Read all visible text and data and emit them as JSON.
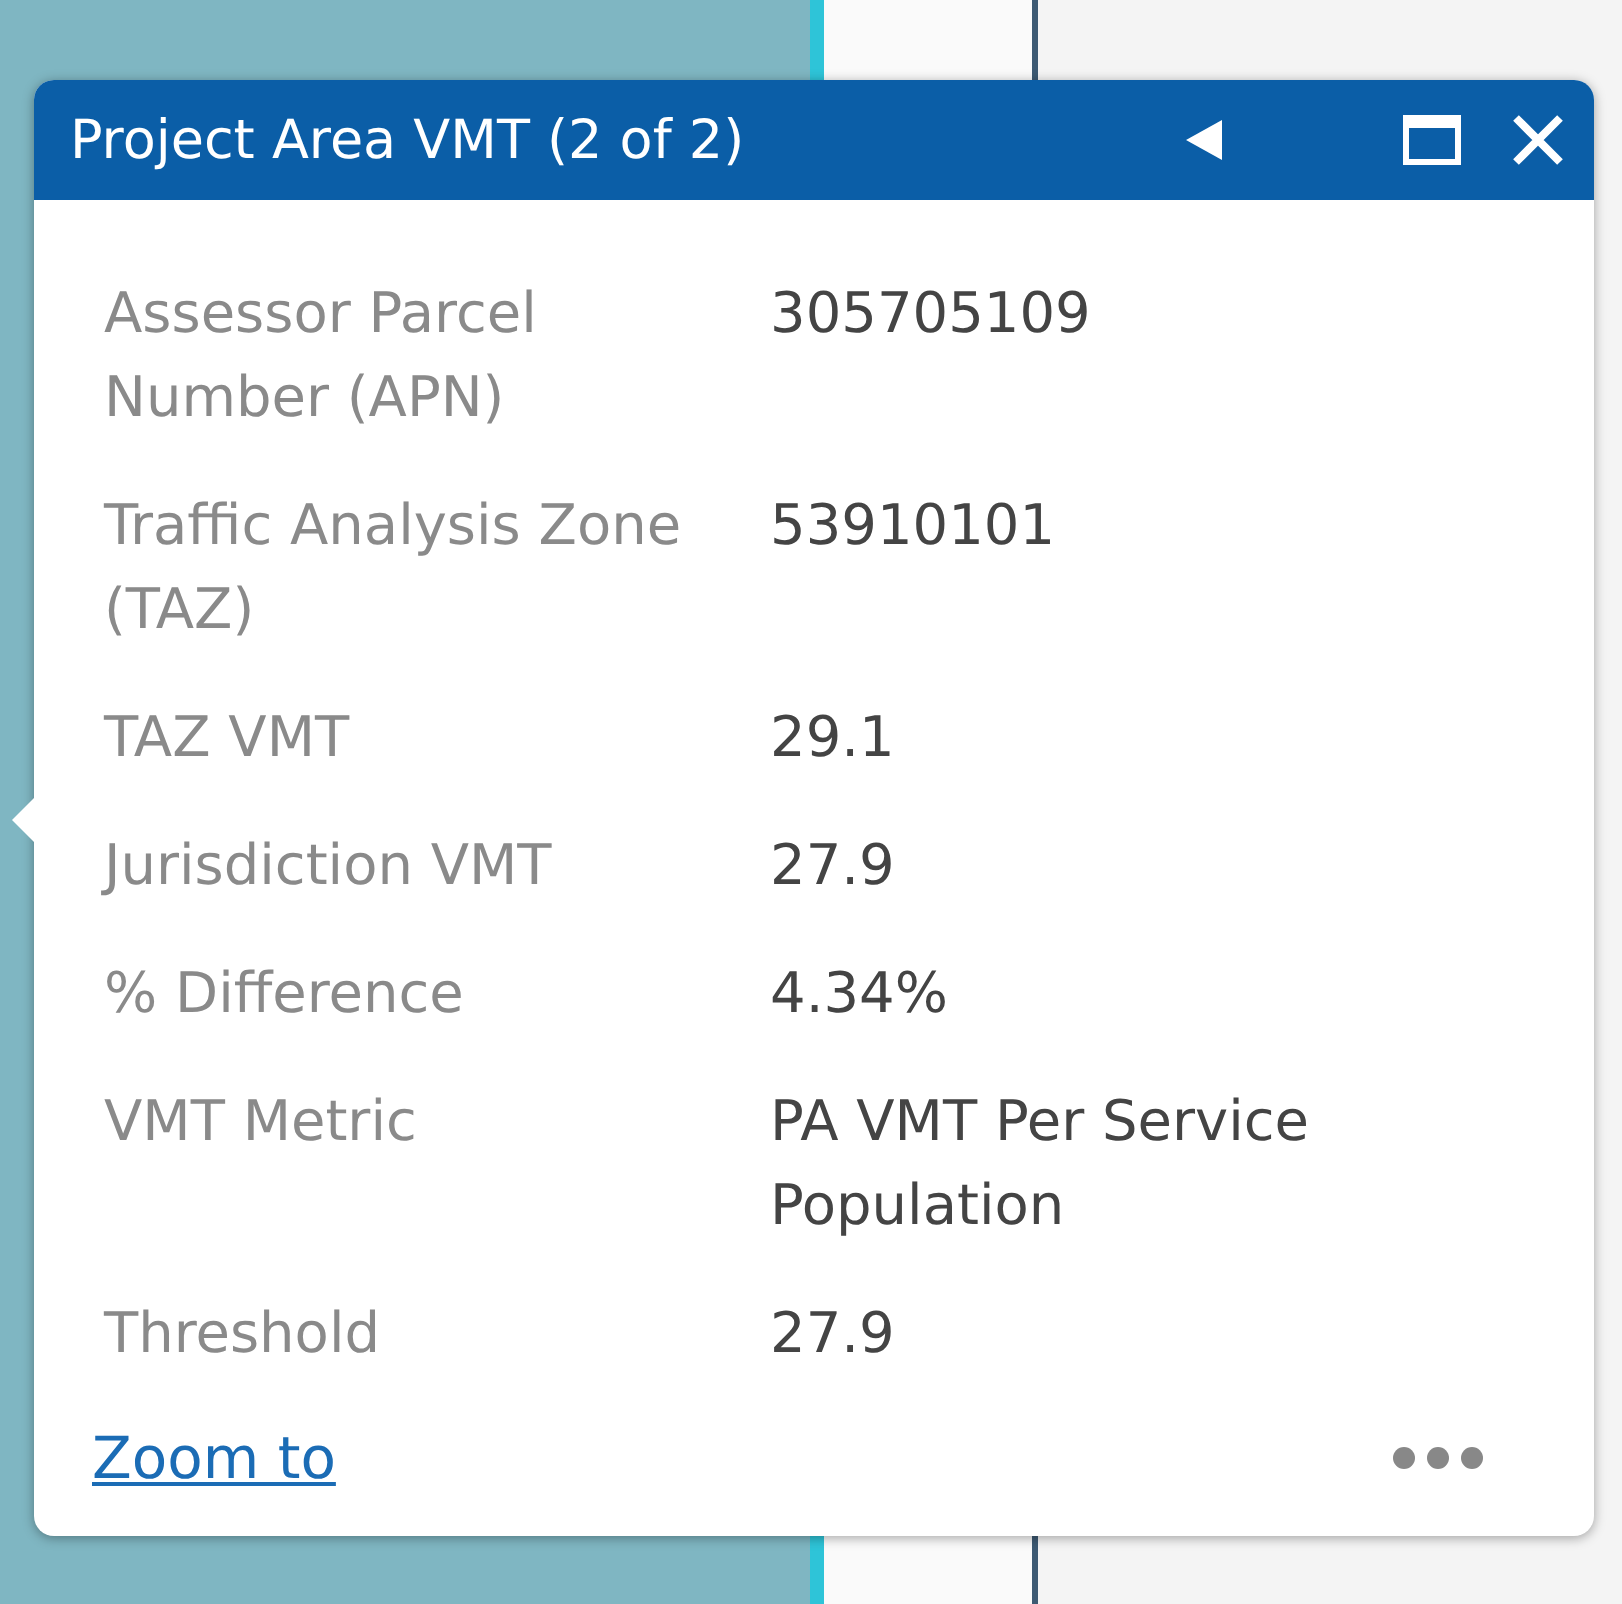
{
  "popup": {
    "title": "Project Area VMT (2 of 2)",
    "fields": [
      {
        "label": "Assessor Parcel Number (APN)",
        "value": "305705109"
      },
      {
        "label": "Traffic Analysis Zone (TAZ)",
        "value": "53910101"
      },
      {
        "label": "TAZ VMT",
        "value": "29.1"
      },
      {
        "label": "Jurisdiction VMT",
        "value": "27.9"
      },
      {
        "label": "% Difference",
        "value": "4.34%"
      },
      {
        "label": "VMT Metric",
        "value": "PA VMT Per Service Population"
      },
      {
        "label": "Threshold",
        "value": "27.9"
      }
    ],
    "link": "Zoom to"
  }
}
